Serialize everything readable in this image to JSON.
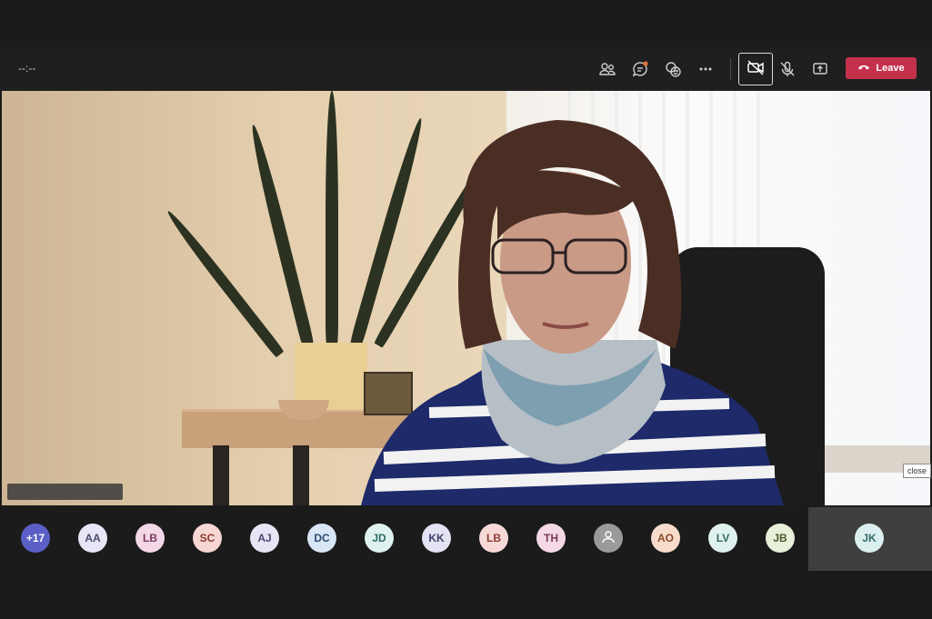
{
  "toolbar": {
    "timer": "--:--",
    "leave_label": "Leave",
    "icons": [
      "participants-icon",
      "chat-icon",
      "reactions-icon",
      "more-icon",
      "camera-off-icon",
      "mic-off-icon",
      "share-icon",
      "hangup-icon"
    ]
  },
  "tooltip": {
    "text": "close"
  },
  "participants": [
    {
      "initials": "+17",
      "color": "#5b5fc7",
      "text_color": "#ffffff"
    },
    {
      "initials": "AA",
      "color": "#e8e6f6",
      "text_color": "#4a4a70"
    },
    {
      "initials": "LB",
      "color": "#f3d7e7",
      "text_color": "#7a3a5c"
    },
    {
      "initials": "SC",
      "color": "#f7d7d4",
      "text_color": "#8a3a32"
    },
    {
      "initials": "AJ",
      "color": "#e7e5f5",
      "text_color": "#4a4a70"
    },
    {
      "initials": "DC",
      "color": "#d9e6f5",
      "text_color": "#2f4c70"
    },
    {
      "initials": "JD",
      "color": "#dff2f0",
      "text_color": "#2f6a62"
    },
    {
      "initials": "KK",
      "color": "#e4e3f3",
      "text_color": "#3f3f6a"
    },
    {
      "initials": "LB",
      "color": "#f7d9d7",
      "text_color": "#8a3a32"
    },
    {
      "initials": "TH",
      "color": "#f5d8e5",
      "text_color": "#7a3a5c"
    },
    {
      "initials": "",
      "color": "#9a9a9a",
      "text_color": "#ffffff",
      "icon": "person-icon"
    },
    {
      "initials": "AO",
      "color": "#f7dccb",
      "text_color": "#8a4a2a"
    },
    {
      "initials": "LV",
      "color": "#dff1ef",
      "text_color": "#2f6a62"
    },
    {
      "initials": "JB",
      "color": "#e8f0da",
      "text_color": "#4a5a2a"
    },
    {
      "initials": "JK",
      "color": "#dcefef",
      "text_color": "#2f6a6a"
    }
  ],
  "colors": {
    "leave": "#c4314b",
    "notification_dot": "#e3743b"
  }
}
